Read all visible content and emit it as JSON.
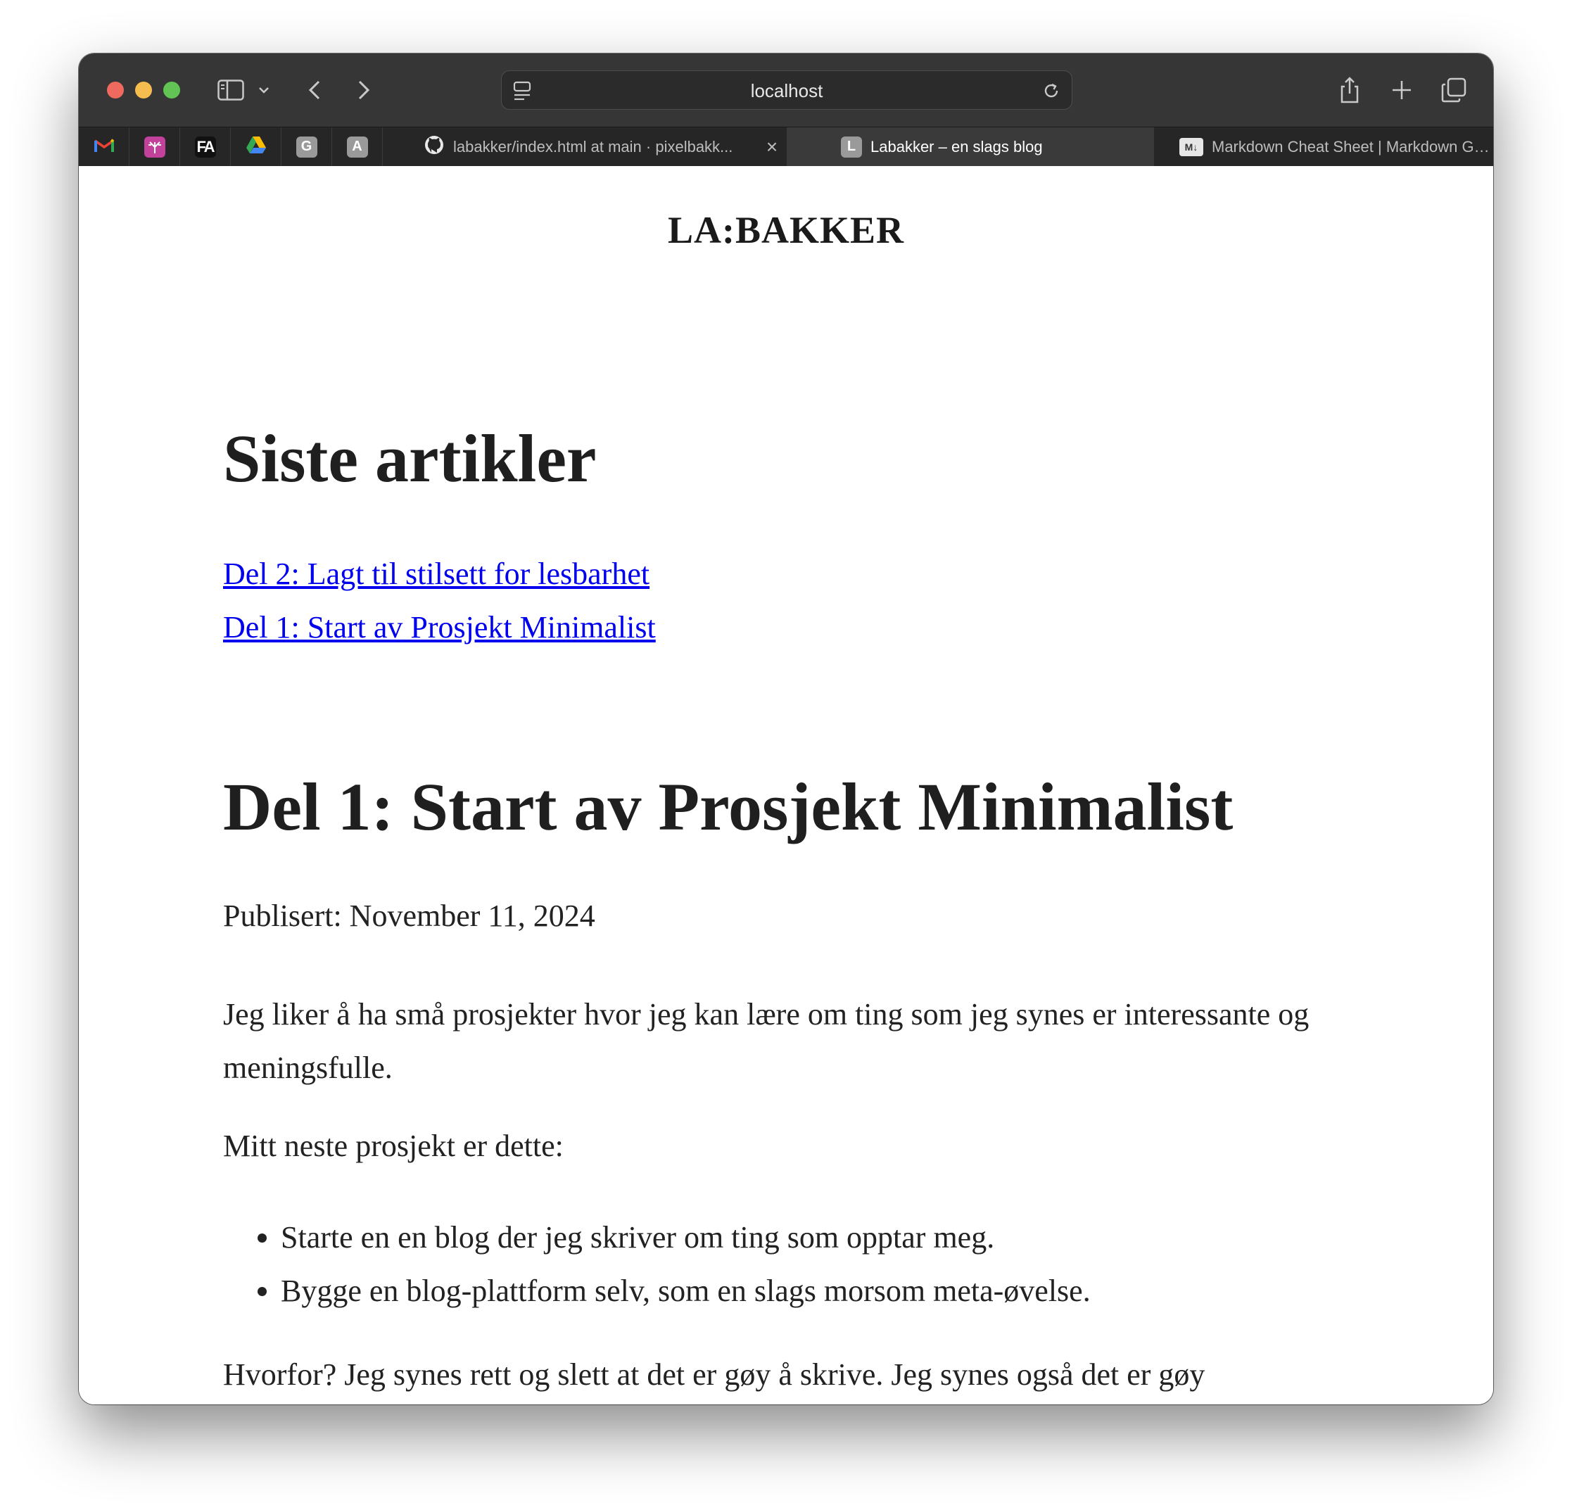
{
  "browser": {
    "address": "localhost",
    "pinned_tabs": [
      {
        "name": "gmail",
        "icon": "gmail-icon",
        "letter": "M"
      },
      {
        "name": "tree",
        "icon": "tree-icon",
        "letter": ""
      },
      {
        "name": "fa",
        "icon": "fa-icon",
        "letter": "FA"
      },
      {
        "name": "drive",
        "icon": "google-drive-icon",
        "letter": ""
      },
      {
        "name": "g",
        "icon": "letter-g-icon",
        "letter": "G"
      },
      {
        "name": "a",
        "icon": "letter-a-icon",
        "letter": "A"
      }
    ],
    "tabs": [
      {
        "label": "labakker/index.html at main · pixelbakk...",
        "icon": "github-icon"
      },
      {
        "label": "Labakker – en slags blog",
        "icon": "letter-l-icon",
        "favicon_letter": "L",
        "active": true
      },
      {
        "label": "Markdown Cheat Sheet | Markdown Gui...",
        "icon": "markdown-icon",
        "favicon_letter": "M↓"
      }
    ],
    "tab_close_glyph": "×"
  },
  "page": {
    "site_title": "LA:BAKKER",
    "recent_heading": "Siste artikler",
    "recent_links": [
      "Del 2: Lagt til stilsett for lesbarhet",
      "Del 1: Start av Prosjekt Minimalist"
    ],
    "article": {
      "title": "Del 1: Start av Prosjekt Minimalist",
      "published": "Publisert: November 11, 2024",
      "paragraph1": "Jeg liker å ha små prosjekter hvor jeg kan lære om ting som jeg synes er interessante og meningsfulle.",
      "paragraph2": "Mitt neste prosjekt er dette:",
      "bullets": [
        "Starte en en blog der jeg skriver om ting som opptar meg.",
        "Bygge en blog-plattform selv, som en slags morsom meta-øvelse."
      ],
      "paragraph3": "Hvorfor? Jeg synes rett og slett at det er gøy å skrive. Jeg synes også det er gøy"
    }
  },
  "colors": {
    "toolbar_bg": "#363636",
    "tabbar_bg": "#262626",
    "active_tab_bg": "#3a3a3a",
    "link": "#0000ee",
    "text": "#222222",
    "close": "#ee6a5e",
    "minimize": "#f5bd4f",
    "maximize": "#61c454"
  }
}
